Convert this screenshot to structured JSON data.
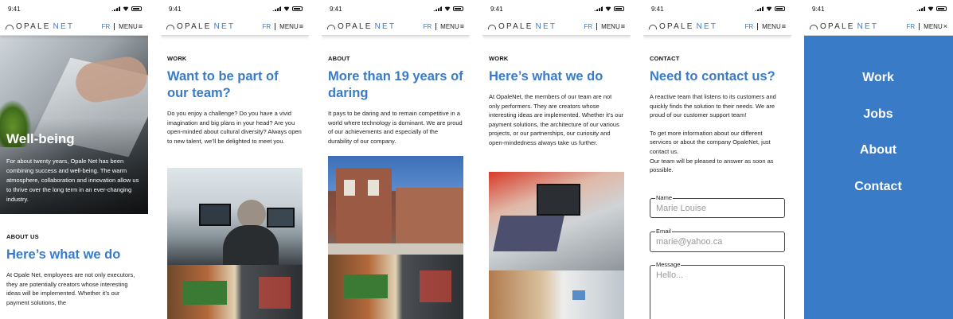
{
  "status": {
    "time": "9:41"
  },
  "nav": {
    "logo_left": "OPALE",
    "logo_right": "NET",
    "lang": "FR",
    "menu": "MENU",
    "menu_icon": "≡",
    "close_icon": "×"
  },
  "screens": {
    "home": {
      "hero_title": "Well-being",
      "hero_text": "For about twenty years, Opale Net has been combining success and well-being. The warm atmosphere, collaboration and innovation allow us to thrive over the long term in an ever-changing industry.",
      "eyebrow": "ABOUT US",
      "heading": "Here’s what we do",
      "body": "At Opale Net, employees are not only executors, they are potentially creators whose interesting ideas will be implemented. Whether it’s our payment solutions, the"
    },
    "work": {
      "eyebrow": "WORK",
      "heading": "Want to be part of our team?",
      "body": "Do you enjoy a challenge? Do you have a vivid imagination and big plans in your head? Are you open-minded about cultural diversity? Always open to new talent, we’ll be delighted to meet you."
    },
    "about": {
      "eyebrow": "ABOUT",
      "heading": "More than 19 years of daring",
      "body": "It pays to be daring and to remain competitive in a world where technology is dominant. We are proud of our achievements and especially of the durability of our company."
    },
    "work2": {
      "eyebrow": "WORK",
      "heading": "Here’s what we do",
      "body": "At OpaleNet, the members of our team are not only performers. They are creators whose interesting ideas are implemented. Whether it’s our payment solutions, the architecture of our various projects, or our partnerships, our curiosity and open-mindedness always take us further."
    },
    "contact": {
      "eyebrow": "CONTACT",
      "heading": "Need to contact us?",
      "body1": "A reactive team that listens to its customers and quickly finds the solution to their needs. We are proud of our customer support team!",
      "body2": "To get more information about our different services or about the company OpaleNet, just contact us.",
      "body3": "Our team will be pleased to answer as soon as possible.",
      "fields": [
        {
          "label": "Name",
          "value": "Marie Louise"
        },
        {
          "label": "Email",
          "value": "marie@yahoo.ca"
        },
        {
          "label": "Message",
          "value": "Hello..."
        }
      ]
    },
    "menu": {
      "items": [
        "Work",
        "Jobs",
        "About",
        "Contact"
      ]
    }
  },
  "colors": {
    "brand_blue": "#3a7bc8",
    "text": "#111111",
    "border": "#444444"
  }
}
